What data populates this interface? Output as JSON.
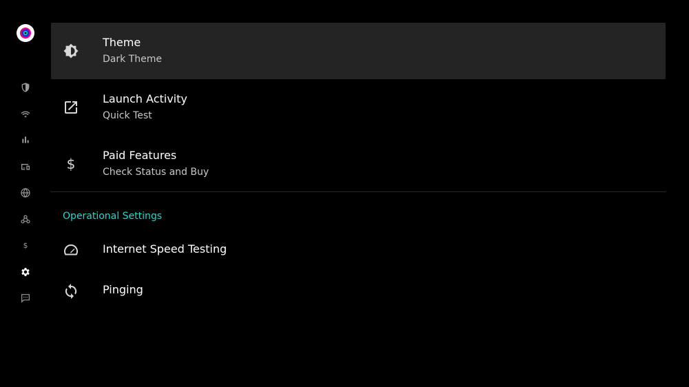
{
  "rail": {
    "logo": "app-logo",
    "items": [
      {
        "id": "shield",
        "icon": "shield-icon",
        "active": false
      },
      {
        "id": "wifi",
        "icon": "wifi-icon",
        "active": false
      },
      {
        "id": "stats",
        "icon": "bar-chart-icon",
        "active": false
      },
      {
        "id": "devices",
        "icon": "devices-icon",
        "active": false
      },
      {
        "id": "globe",
        "icon": "globe-icon",
        "active": false
      },
      {
        "id": "webhook",
        "icon": "webhook-icon",
        "active": false
      },
      {
        "id": "dollar",
        "icon": "dollar-icon",
        "active": false
      },
      {
        "id": "settings",
        "icon": "gear-icon",
        "active": true
      },
      {
        "id": "feedback",
        "icon": "chat-icon",
        "active": false
      }
    ]
  },
  "settings": {
    "items": [
      {
        "title": "Theme",
        "subtitle": "Dark Theme",
        "icon": "brightness-icon",
        "selected": true
      },
      {
        "title": "Launch Activity",
        "subtitle": "Quick Test",
        "icon": "open-in-new-icon",
        "selected": false
      },
      {
        "title": "Paid Features",
        "subtitle": "Check Status and Buy",
        "icon": "dollar-icon",
        "selected": false
      }
    ],
    "section_header": "Operational Settings",
    "operational_items": [
      {
        "title": "Internet Speed Testing",
        "icon": "speedometer-icon"
      },
      {
        "title": "Pinging",
        "icon": "sync-icon"
      }
    ]
  },
  "colors": {
    "background": "#000000",
    "selected_row": "#242424",
    "accent": "#2bd5c9",
    "rail_icon": "#9a9a9a",
    "rail_icon_active": "#ffffff"
  }
}
